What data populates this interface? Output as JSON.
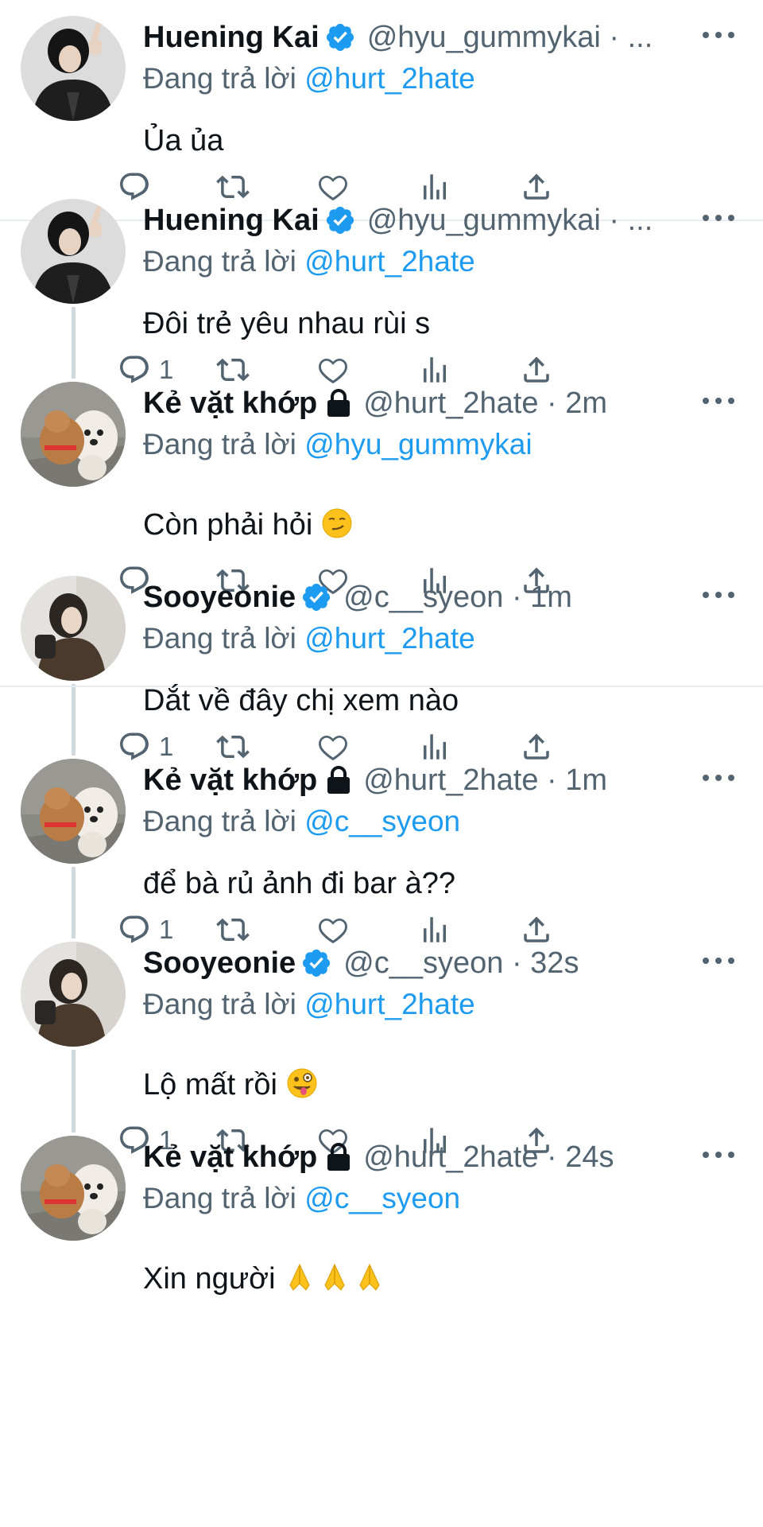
{
  "tweets": [
    {
      "name": "Huening Kai",
      "verified": true,
      "locked": false,
      "handle": "@hyu_gummykai · ...",
      "reply_prefix": "Đang trả lời",
      "reply_to": "@hurt_2hate",
      "text": "Ủa ủa",
      "emoji": "",
      "replies": "",
      "avatar": "person-dark"
    },
    {
      "name": "Huening Kai",
      "verified": true,
      "locked": false,
      "handle": "@hyu_gummykai · ...",
      "reply_prefix": "Đang trả lời",
      "reply_to": "@hurt_2hate",
      "text": "Đôi trẻ yêu nhau rùi s",
      "emoji": "",
      "replies": "1",
      "avatar": "person-dark"
    },
    {
      "name": "Kẻ vặt khớp",
      "verified": false,
      "locked": true,
      "handle": "@hurt_2hate · 2m",
      "reply_prefix": "Đang trả lời",
      "reply_to": "@hyu_gummykai",
      "text": "Còn phải hỏi",
      "emoji": "smirk",
      "replies": "",
      "avatar": "dog"
    },
    {
      "name": "Sooyeonie",
      "verified": true,
      "locked": false,
      "handle": "@c__syeon · 1m",
      "reply_prefix": "Đang trả lời",
      "reply_to": "@hurt_2hate",
      "text": "Dắt về đây chị xem nào",
      "emoji": "",
      "replies": "1",
      "avatar": "person-light"
    },
    {
      "name": "Kẻ vặt khớp",
      "verified": false,
      "locked": true,
      "handle": "@hurt_2hate · 1m",
      "reply_prefix": "Đang trả lời",
      "reply_to": "@c__syeon",
      "text": "để bà rủ ảnh đi bar à??",
      "emoji": "",
      "replies": "1",
      "avatar": "dog"
    },
    {
      "name": "Sooyeonie",
      "verified": true,
      "locked": false,
      "handle": "@c__syeon · 32s",
      "reply_prefix": "Đang trả lời",
      "reply_to": "@hurt_2hate",
      "text": "Lộ mất rồi",
      "emoji": "zany",
      "replies": "1",
      "avatar": "person-light"
    },
    {
      "name": "Kẻ vặt khớp",
      "verified": false,
      "locked": true,
      "handle": "@hurt_2hate · 24s",
      "reply_prefix": "Đang trả lời",
      "reply_to": "@c__syeon",
      "text": "Xin người",
      "emoji": "pray3",
      "replies": "",
      "avatar": "dog"
    }
  ],
  "colors": {
    "accent": "#1d9bf0",
    "muted": "#536471",
    "text": "#0f1419",
    "thread_line": "#cfd9de",
    "separator": "#e6ecf0"
  },
  "icons": [
    "reply-icon",
    "retweet-icon",
    "like-icon",
    "views-icon",
    "share-icon",
    "verified-icon",
    "lock-icon",
    "more-icon"
  ]
}
